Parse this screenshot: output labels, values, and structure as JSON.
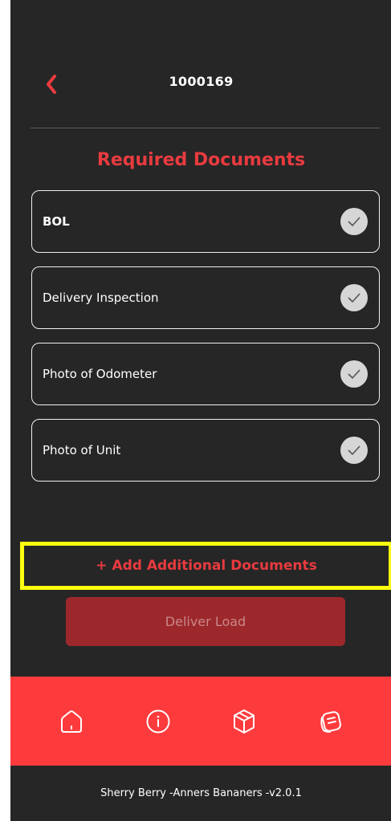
{
  "header": {
    "title": "1000169",
    "back_icon": "chevron-left-icon"
  },
  "colors": {
    "background": "#262626",
    "accent": "#e83b3f",
    "nav_bar": "#fd3b3d",
    "highlight": "#fbfc0f",
    "button_disabled": "#9d282c"
  },
  "section": {
    "title": "Required Documents"
  },
  "documents": [
    {
      "label": "BOL",
      "status_icon": "check-circle-icon"
    },
    {
      "label": "Delivery Inspection",
      "status_icon": "check-circle-icon"
    },
    {
      "label": "Photo of Odometer",
      "status_icon": "check-circle-icon"
    },
    {
      "label": "Photo of Unit",
      "status_icon": "check-circle-icon"
    }
  ],
  "actions": {
    "add_docs_label": "+ Add Additional Documents",
    "deliver_label": "Deliver Load"
  },
  "nav": {
    "items": [
      "home-icon",
      "info-icon",
      "package-icon",
      "notes-icon"
    ]
  },
  "footer": {
    "text": "Sherry Berry  -Anners Bananers  -v2.0.1"
  }
}
